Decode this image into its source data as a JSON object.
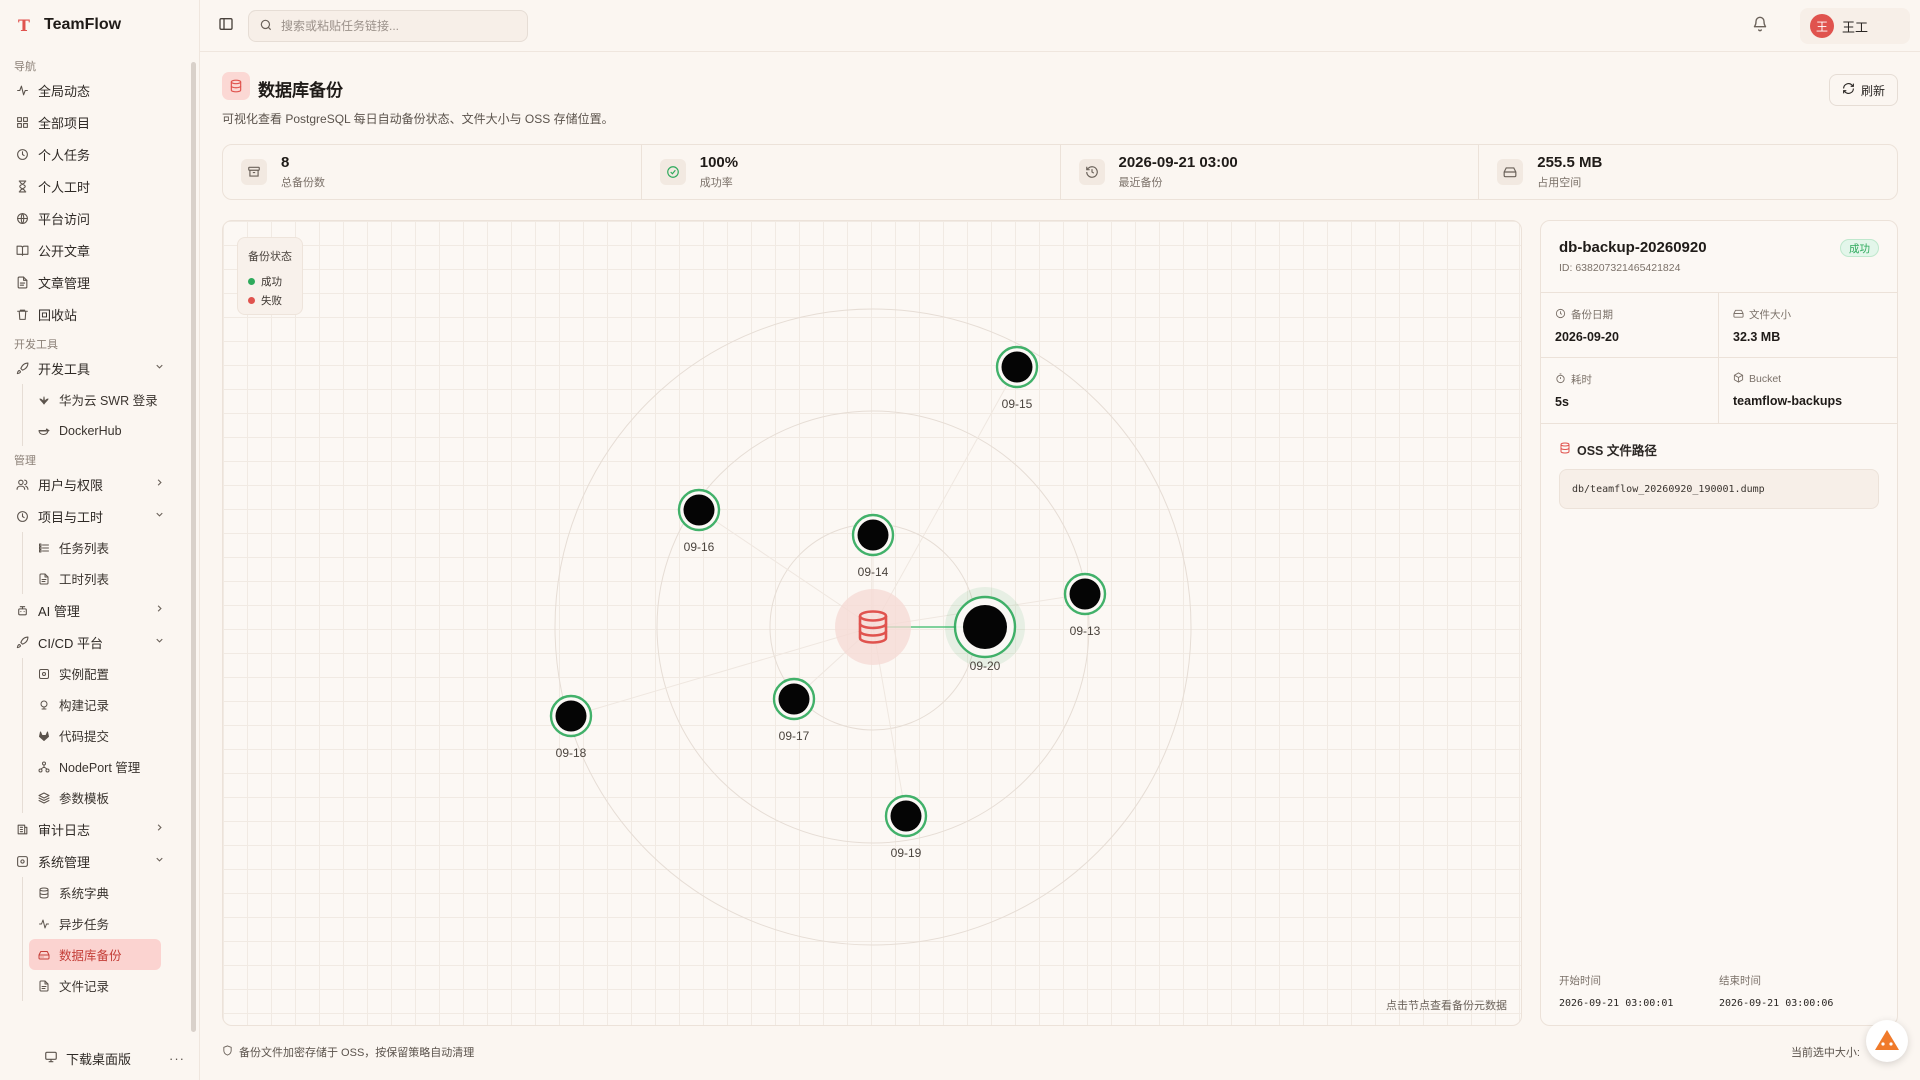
{
  "app": {
    "name": "TeamFlow",
    "logo_glyph": "T"
  },
  "sidebar": {
    "sections": [
      {
        "label": "导航",
        "items": [
          {
            "label": "全局动态",
            "icon": "activity-icon"
          },
          {
            "label": "全部项目",
            "icon": "grid-icon"
          },
          {
            "label": "个人任务",
            "icon": "clock-icon"
          },
          {
            "label": "个人工时",
            "icon": "hourglass-icon"
          },
          {
            "label": "平台访问",
            "icon": "globe-icon"
          },
          {
            "label": "公开文章",
            "icon": "book-icon"
          },
          {
            "label": "文章管理",
            "icon": "file-icon"
          },
          {
            "label": "回收站",
            "icon": "trash-icon"
          }
        ]
      },
      {
        "label": "开发工具",
        "items": [
          {
            "label": "开发工具",
            "icon": "rocket-icon",
            "chevron": "down",
            "children": [
              {
                "label": "华为云 SWR 登录",
                "icon": "huawei-icon"
              },
              {
                "label": "DockerHub",
                "icon": "docker-icon"
              }
            ]
          }
        ]
      },
      {
        "label": "管理",
        "items": [
          {
            "label": "用户与权限",
            "icon": "users-icon",
            "chevron": "right"
          },
          {
            "label": "项目与工时",
            "icon": "clock-icon",
            "chevron": "down",
            "children": [
              {
                "label": "任务列表",
                "icon": "list-icon"
              },
              {
                "label": "工时列表",
                "icon": "file-icon"
              }
            ]
          },
          {
            "label": "AI 管理",
            "icon": "cpu-icon",
            "chevron": "right"
          },
          {
            "label": "CI/CD 平台",
            "icon": "rocket-icon",
            "chevron": "down",
            "children": [
              {
                "label": "实例配置",
                "icon": "settings-icon"
              },
              {
                "label": "构建记录",
                "icon": "history-icon"
              },
              {
                "label": "代码提交",
                "icon": "gitlab-icon"
              },
              {
                "label": "NodePort 管理",
                "icon": "network-icon"
              },
              {
                "label": "参数模板",
                "icon": "layers-icon"
              }
            ]
          },
          {
            "label": "审计日志",
            "icon": "log-icon",
            "chevron": "right"
          },
          {
            "label": "系统管理",
            "icon": "settings-icon",
            "chevron": "down",
            "children": [
              {
                "label": "系统字典",
                "icon": "database-icon"
              },
              {
                "label": "异步任务",
                "icon": "activity-icon"
              },
              {
                "label": "数据库备份",
                "icon": "drive-icon",
                "active": true
              },
              {
                "label": "文件记录",
                "icon": "file-icon"
              }
            ]
          }
        ]
      }
    ],
    "footer": {
      "label": "下载桌面版",
      "more": "···"
    }
  },
  "topbar": {
    "search_placeholder": "搜索或粘贴任务链接...",
    "user": {
      "avatar": "王",
      "name": "王工"
    }
  },
  "page": {
    "title": "数据库备份",
    "description": "可视化查看 PostgreSQL 每日自动备份状态、文件大小与 OSS 存储位置。",
    "refresh_label": "刷新"
  },
  "stats": [
    {
      "value": "8",
      "label": "总备份数",
      "icon": "archive-icon"
    },
    {
      "value": "100%",
      "label": "成功率",
      "icon": "check-circle-icon"
    },
    {
      "value": "2026-09-21 03:00",
      "label": "最近备份",
      "icon": "history-icon"
    },
    {
      "value": "255.5 MB",
      "label": "占用空间",
      "icon": "drive-icon"
    }
  ],
  "canvas": {
    "legend": {
      "title": "备份状态",
      "success": "成功",
      "failed": "失败"
    },
    "colors": {
      "success": "#2eaa5c",
      "failed": "#e0534e",
      "center": "#e0534e"
    },
    "hint": "点击节点查看备份元数据",
    "selected": "09-20",
    "nodes": [
      {
        "label": "09-13",
        "status": "success"
      },
      {
        "label": "09-14",
        "status": "success"
      },
      {
        "label": "09-15",
        "status": "success"
      },
      {
        "label": "09-16",
        "status": "success"
      },
      {
        "label": "09-17",
        "status": "success"
      },
      {
        "label": "09-18",
        "status": "success"
      },
      {
        "label": "09-19",
        "status": "success"
      },
      {
        "label": "09-20",
        "status": "success"
      }
    ]
  },
  "detail": {
    "title": "db-backup-20260920",
    "id": "ID: 638207321465421824",
    "status": "成功",
    "fields": [
      {
        "label": "备份日期",
        "value": "2026-09-20",
        "icon": "clock-icon"
      },
      {
        "label": "文件大小",
        "value": "32.3 MB",
        "icon": "drive-icon"
      },
      {
        "label": "耗时",
        "value": "5s",
        "icon": "timer-icon"
      },
      {
        "label": "Bucket",
        "value": "teamflow-backups",
        "icon": "bucket-icon"
      }
    ],
    "oss_label": "OSS 文件路径",
    "oss_path": "db/teamflow_20260920_190001.dump",
    "start_label": "开始时间",
    "start_value": "2026-09-21 03:00:01",
    "end_label": "结束时间",
    "end_value": "2026-09-21 03:00:06"
  },
  "footer": {
    "note": "备份文件加密存储于 OSS，按保留策略自动清理",
    "right": "当前选中大小:"
  }
}
